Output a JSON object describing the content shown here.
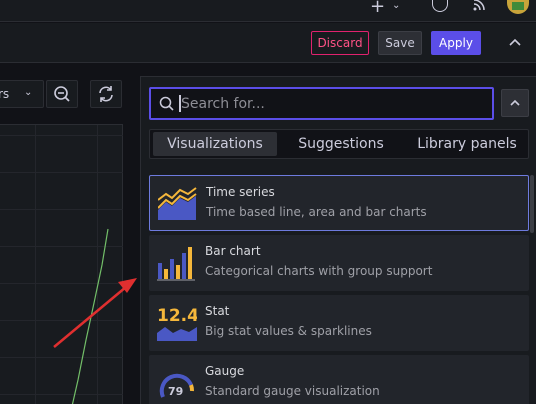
{
  "toolbar": {
    "discard_label": "Discard",
    "save_label": "Save",
    "apply_label": "Apply"
  },
  "left": {
    "range_partial": "rs"
  },
  "search": {
    "placeholder": "Search for..."
  },
  "tabs": [
    {
      "label": "Visualizations",
      "active": true
    },
    {
      "label": "Suggestions",
      "active": false
    },
    {
      "label": "Library panels",
      "active": false
    }
  ],
  "visualizations": [
    {
      "title": "Time series",
      "description": "Time based line, area and bar charts",
      "icon": "time-series-icon",
      "selected": true
    },
    {
      "title": "Bar chart",
      "description": "Categorical charts with group support",
      "icon": "bar-chart-icon",
      "selected": false
    },
    {
      "title": "Stat",
      "description": "Big stat values & sparklines",
      "icon": "stat-icon",
      "icon_text": "12.4",
      "selected": false
    },
    {
      "title": "Gauge",
      "description": "Standard gauge visualization",
      "icon": "gauge-icon",
      "icon_text": "79",
      "selected": false
    }
  ],
  "colors": {
    "accent": "#5b4ee8",
    "discard": "#e0226e",
    "chart_yellow": "#f5b73b",
    "chart_blue": "#4a58c4",
    "line_green": "#73bf69",
    "annotation_red": "#e02f2f"
  }
}
